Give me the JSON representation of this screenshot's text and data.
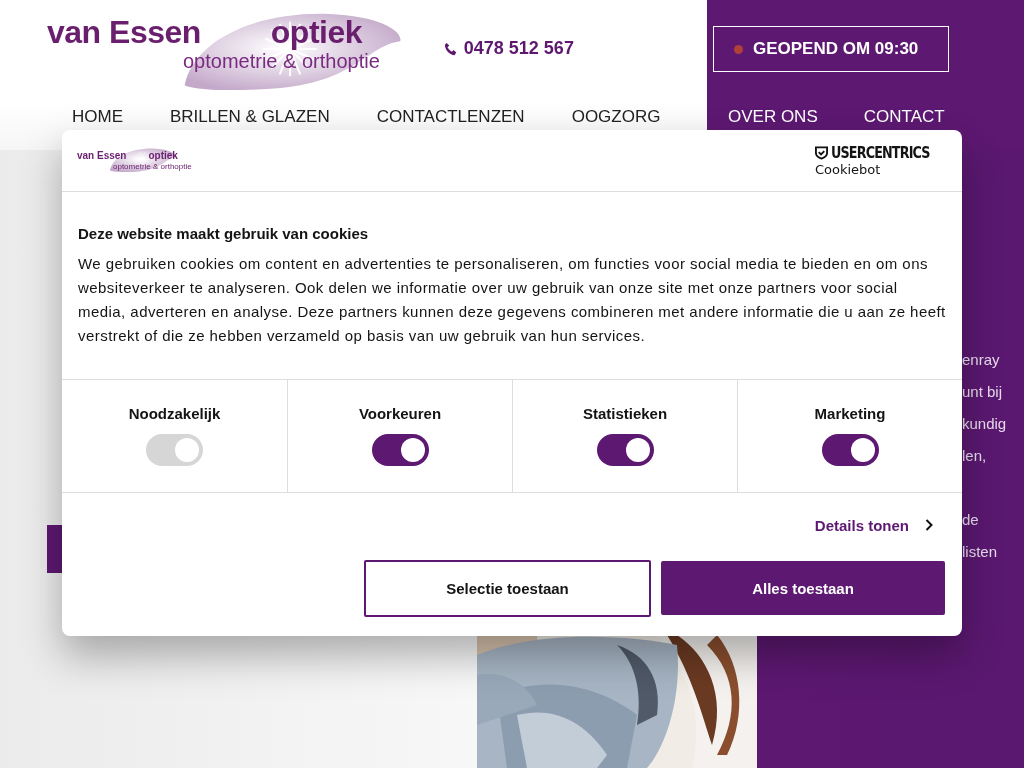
{
  "header": {
    "logo": {
      "name": "van Essen",
      "suffix": "optiek",
      "tagline": "optometrie & orthoptie"
    },
    "phone": "0478 512 567",
    "open_status": {
      "text": "GEOPEND OM 09:30",
      "open": false
    }
  },
  "nav_left": [
    "HOME",
    "BRILLEN & GLAZEN",
    "CONTACTLENZEN",
    "OOGZORG"
  ],
  "nav_right": [
    "OVER ONS",
    "CONTACT"
  ],
  "side_text": [
    "enray",
    "unt bij",
    "kundig",
    "len,",
    "de",
    "listen"
  ],
  "cookie_dialog": {
    "logo": {
      "name": "van Essen",
      "suffix": "optiek",
      "tagline": "optometrie & orthoptie"
    },
    "provider": {
      "brand": "USERCENTRICS",
      "product": "Cookiebot"
    },
    "title": "Deze website maakt gebruik van cookies",
    "text": "We gebruiken cookies om content en advertenties te personaliseren, om functies voor social media te bieden en om ons websiteverkeer te analyseren. Ook delen we informatie over uw gebruik van onze site met onze partners voor social media, adverteren en analyse. Deze partners kunnen deze gegevens combineren met andere informatie die u aan ze heeft verstrekt of die ze hebben verzameld op basis van uw gebruik van hun services.",
    "categories": [
      {
        "label": "Noodzakelijk",
        "on": true,
        "disabled": true
      },
      {
        "label": "Voorkeuren",
        "on": true,
        "disabled": false
      },
      {
        "label": "Statistieken",
        "on": true,
        "disabled": false
      },
      {
        "label": "Marketing",
        "on": true,
        "disabled": false
      }
    ],
    "details_link": "Details tonen",
    "buttons": [
      {
        "label": "Selectie toestaan",
        "kind": "outline"
      },
      {
        "label": "Alles toestaan",
        "kind": "filled"
      }
    ]
  }
}
